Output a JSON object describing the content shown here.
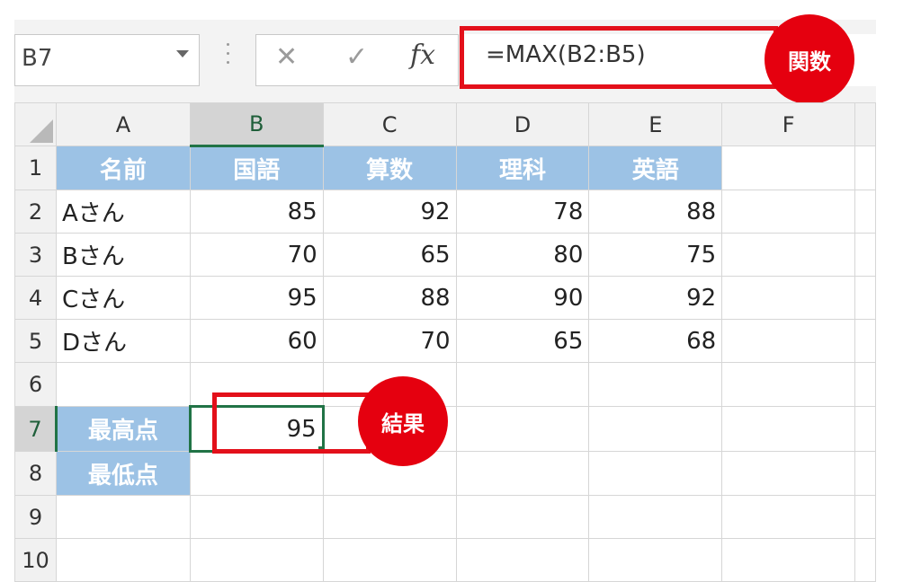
{
  "formula_bar": {
    "name_box": "B7",
    "cancel_icon": "cancel-x-icon",
    "enter_icon": "check-icon",
    "fx_label": "fx",
    "formula": "=MAX(B2:B5)"
  },
  "annotations": {
    "function_badge": "関数",
    "result_badge": "結果",
    "highlight_color": "#e5000f"
  },
  "columns": [
    "A",
    "B",
    "C",
    "D",
    "E",
    "F"
  ],
  "rows": [
    "1",
    "2",
    "3",
    "4",
    "5",
    "6",
    "7",
    "8",
    "9",
    "10"
  ],
  "selected_column": "B",
  "selected_row": "7",
  "cells": {
    "A1": "名前",
    "B1": "国語",
    "C1": "算数",
    "D1": "理科",
    "E1": "英語",
    "A2": "Aさん",
    "B2": "85",
    "C2": "92",
    "D2": "78",
    "E2": "88",
    "A3": "Bさん",
    "B3": "70",
    "C3": "65",
    "D3": "80",
    "E3": "75",
    "A4": "Cさん",
    "B4": "95",
    "C4": "88",
    "D4": "90",
    "E4": "92",
    "A5": "Dさん",
    "B5": "60",
    "C5": "70",
    "D5": "65",
    "E5": "68",
    "A7": "最高点",
    "B7": "95",
    "A8": "最低点"
  },
  "colors": {
    "header_fill": "#9cc2e5",
    "selection_green": "#217346"
  }
}
